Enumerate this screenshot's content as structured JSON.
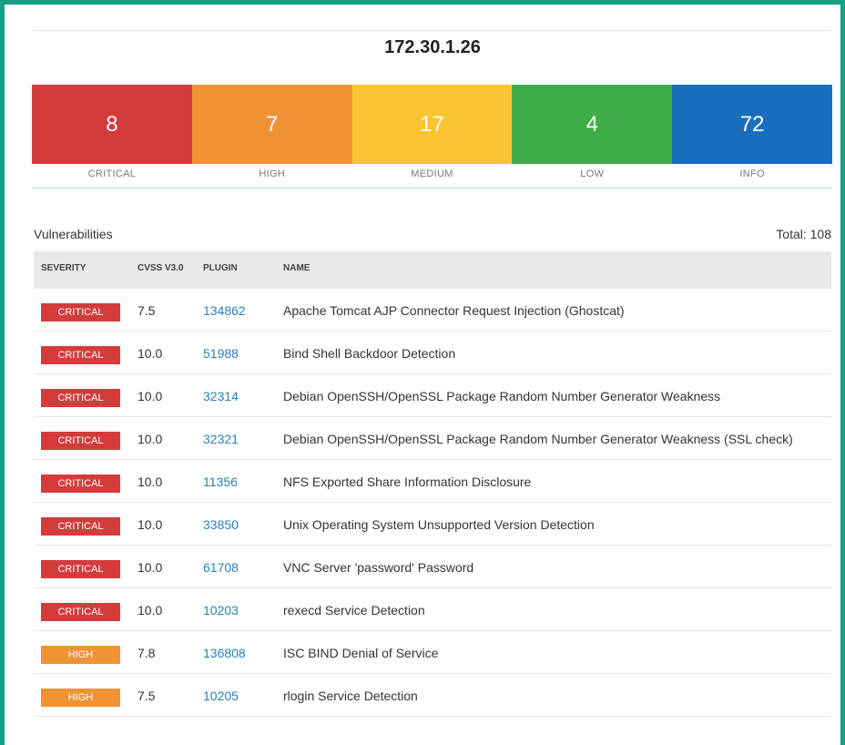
{
  "host": "172.30.1.26",
  "summary": [
    {
      "count": "8",
      "label": "CRITICAL",
      "color": "#d43c3c"
    },
    {
      "count": "7",
      "label": "HIGH",
      "color": "#ee9336"
    },
    {
      "count": "17",
      "label": "MEDIUM",
      "color": "#fdc431"
    },
    {
      "count": "4",
      "label": "LOW",
      "color": "#3fae49"
    },
    {
      "count": "72",
      "label": "INFO",
      "color": "#1a6fbd"
    }
  ],
  "vulnerabilities": {
    "title": "Vulnerabilities",
    "total": "Total: 108",
    "columns": [
      "SEVERITY",
      "CVSS V3.0",
      "PLUGIN",
      "NAME"
    ],
    "rows": [
      {
        "severity": "CRITICAL",
        "color": "#d43c3c",
        "cvss": "7.5",
        "plugin": "134862",
        "name": "Apache Tomcat AJP Connector Request Injection (Ghostcat)"
      },
      {
        "severity": "CRITICAL",
        "color": "#d43c3c",
        "cvss": "10.0",
        "plugin": "51988",
        "name": "Bind Shell Backdoor Detection"
      },
      {
        "severity": "CRITICAL",
        "color": "#d43c3c",
        "cvss": "10.0",
        "plugin": "32314",
        "name": "Debian OpenSSH/OpenSSL Package Random Number Generator Weakness"
      },
      {
        "severity": "CRITICAL",
        "color": "#d43c3c",
        "cvss": "10.0",
        "plugin": "32321",
        "name": "Debian OpenSSH/OpenSSL Package Random Number Generator Weakness (SSL check)"
      },
      {
        "severity": "CRITICAL",
        "color": "#d43c3c",
        "cvss": "10.0",
        "plugin": "11356",
        "name": "NFS Exported Share Information Disclosure"
      },
      {
        "severity": "CRITICAL",
        "color": "#d43c3c",
        "cvss": "10.0",
        "plugin": "33850",
        "name": "Unix Operating System Unsupported Version Detection"
      },
      {
        "severity": "CRITICAL",
        "color": "#d43c3c",
        "cvss": "10.0",
        "plugin": "61708",
        "name": "VNC Server 'password' Password"
      },
      {
        "severity": "CRITICAL",
        "color": "#d43c3c",
        "cvss": "10.0",
        "plugin": "10203",
        "name": "rexecd Service Detection"
      },
      {
        "severity": "HIGH",
        "color": "#ee9336",
        "cvss": "7.8",
        "plugin": "136808",
        "name": "ISC BIND Denial of Service"
      },
      {
        "severity": "HIGH",
        "color": "#ee9336",
        "cvss": "7.5",
        "plugin": "10205",
        "name": "rlogin Service Detection"
      }
    ]
  }
}
